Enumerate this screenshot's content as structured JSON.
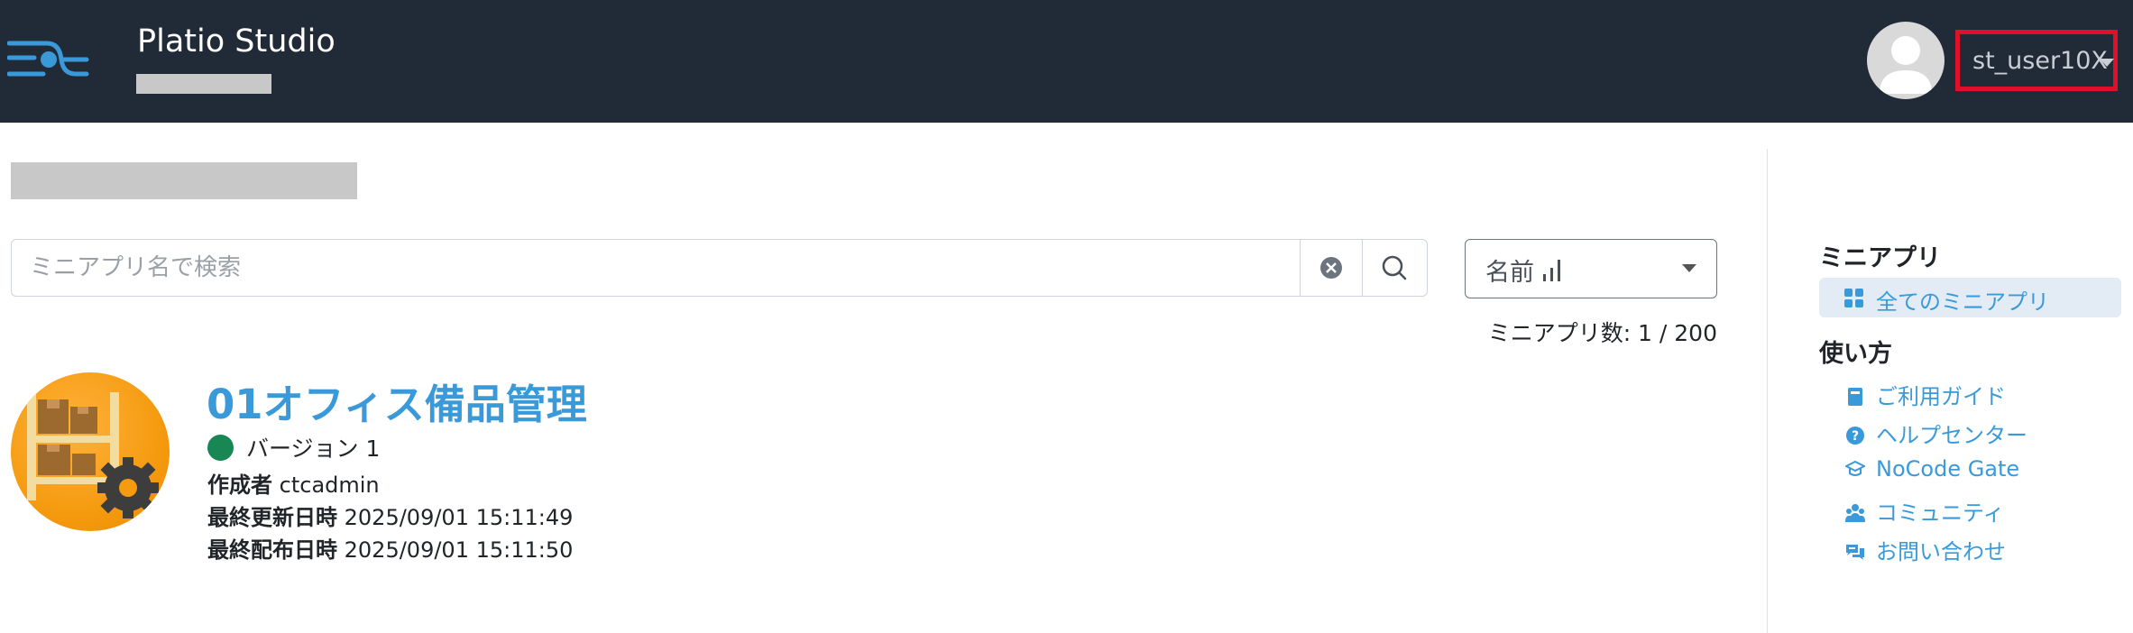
{
  "header": {
    "app_title": "Platio Studio",
    "user_name": "st_user10X"
  },
  "search": {
    "placeholder": "ミニアプリ名で検索",
    "value": ""
  },
  "sort": {
    "selected": "名前"
  },
  "count_text": "ミニアプリ数: 1 / 200",
  "app": {
    "name": "01オフィス備品管理",
    "version": "バージョン 1",
    "creator_label": "作成者",
    "creator": "ctcadmin",
    "updated_label": "最終更新日時",
    "updated": "2025/09/01 15:11:49",
    "published_label": "最終配布日時",
    "published": "2025/09/01 15:11:50"
  },
  "sidebar": {
    "section1_title": "ミニアプリ",
    "all_apps": "全てのミニアプリ",
    "section2_title": "使い方",
    "items": [
      {
        "label": "ご利用ガイド",
        "icon": "book-icon"
      },
      {
        "label": "ヘルプセンター",
        "icon": "question-circle-icon"
      },
      {
        "label": "NoCode Gate",
        "icon": "graduation-cap-icon"
      },
      {
        "label": "コミュニティ",
        "icon": "users-icon"
      },
      {
        "label": "お問い合わせ",
        "icon": "comments-icon"
      }
    ]
  },
  "colors": {
    "header_bg": "#212b37",
    "link": "#3a9ad9",
    "status_green": "#198754",
    "highlight_border": "#e0102a"
  }
}
